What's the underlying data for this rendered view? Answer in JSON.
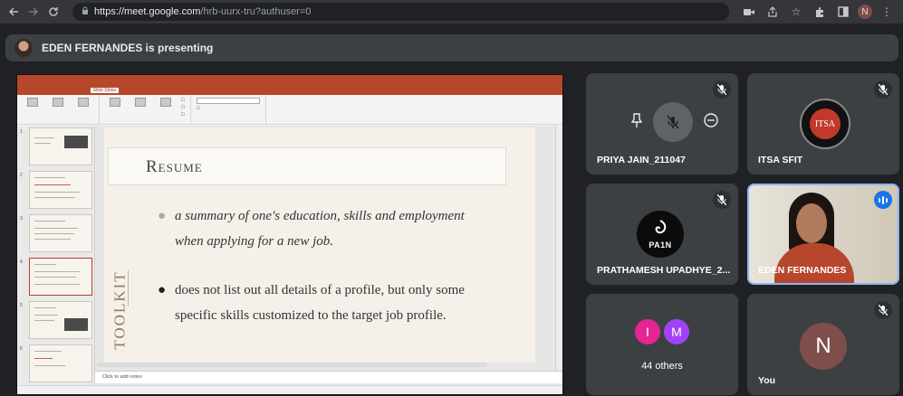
{
  "browser": {
    "url_main": "https://meet.google.com",
    "url_rest": "/hrb-uurx-tru?authuser=0",
    "profile_initial": "N",
    "icons": [
      "back-icon",
      "forward-icon",
      "reload-icon",
      "lock-icon",
      "camera-icon",
      "share-icon",
      "bookmark-star-icon",
      "extensions-icon",
      "sidebar-icon",
      "menu-icon"
    ]
  },
  "banner": {
    "text": "EDEN FERNANDES is presenting"
  },
  "presentation": {
    "slide_title": "Resume",
    "bullet1": "a summary of one's education, skills and employment when applying for a new job.",
    "bullet2": "does not list out all details of a profile, but only some specific skills customized to the target job profile.",
    "side_text": "TOOLKIT",
    "notes_placeholder": "Click to add notes",
    "thumbnail_numbers": [
      "1",
      "2",
      "3",
      "4",
      "5",
      "6"
    ],
    "active_tab": "Slide Show"
  },
  "participants": [
    {
      "name": "PRIYA JAIN_211047",
      "muted": true
    },
    {
      "name": "ITSA SFIT",
      "muted": true,
      "logo_text": "ITSA"
    },
    {
      "name": "PRATHAMESH UPADHYE_2...",
      "muted": true,
      "logo_text": "PA1N"
    },
    {
      "name": "EDEN FERNANDES",
      "speaking": true
    },
    {
      "others_count": "44 others",
      "avatars": [
        {
          "initial": "I",
          "color": "#e52592"
        },
        {
          "initial": "M",
          "color": "#a142f4"
        }
      ]
    },
    {
      "name": "You",
      "muted": true,
      "initial": "N",
      "color": "#7d4e4a"
    }
  ]
}
